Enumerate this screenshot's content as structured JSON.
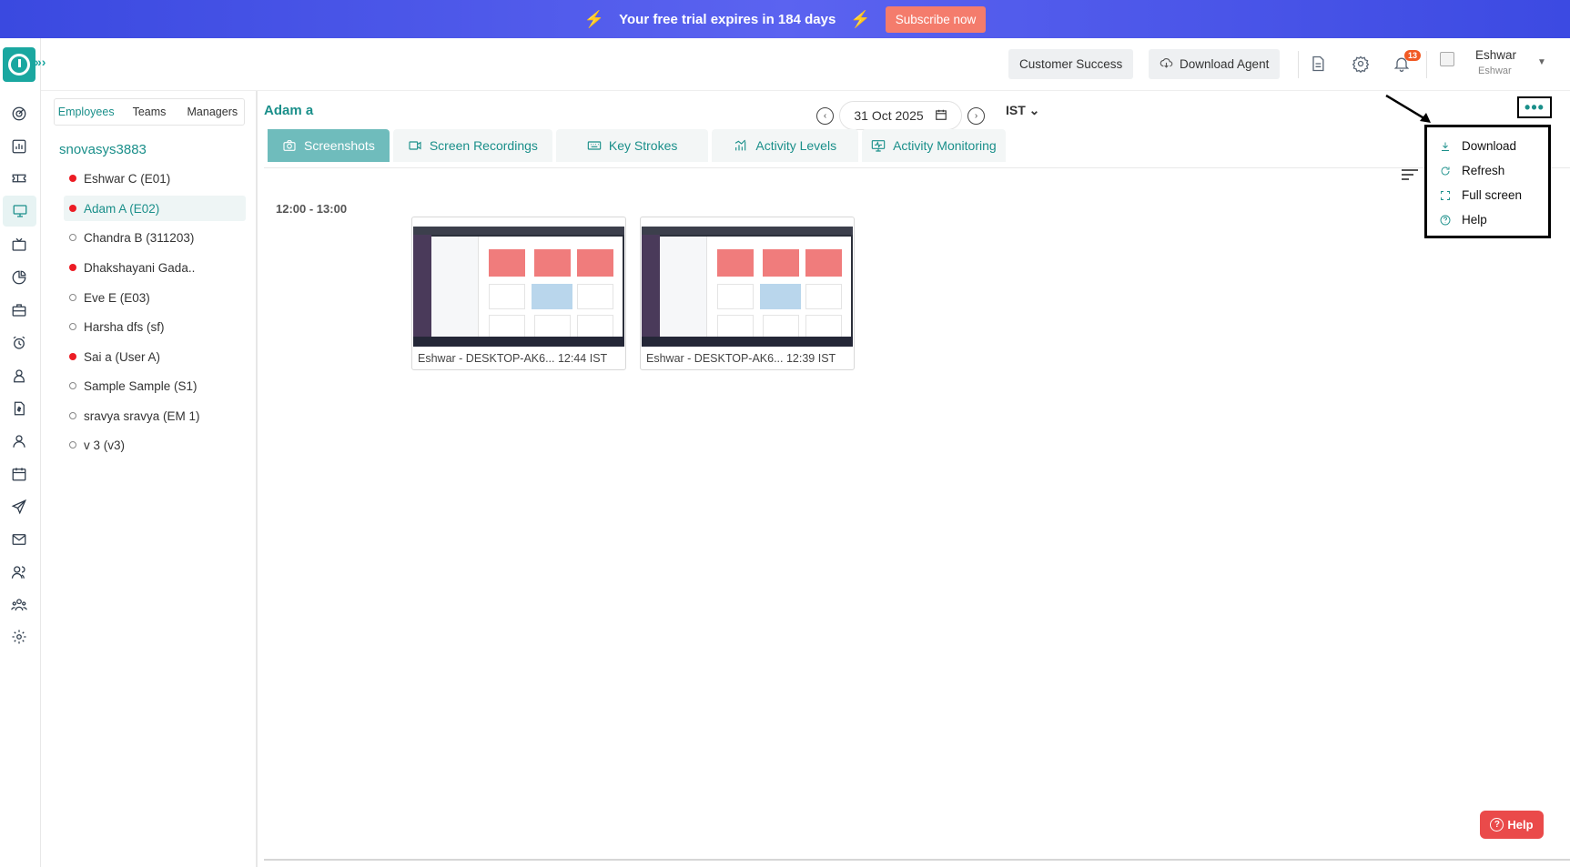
{
  "banner": {
    "message": "Your free trial expires in 184 days",
    "subscribe_label": "Subscribe now"
  },
  "header": {
    "customer_success_label": "Customer Success",
    "download_agent_label": "Download Agent",
    "notification_count": "13",
    "user_name": "Eshwar",
    "user_subtitle": "Eshwar"
  },
  "sidebar": {
    "icons": [
      "dashboard-icon",
      "chart-icon",
      "ticket-icon",
      "monitor-icon",
      "tv-icon",
      "pie-chart-icon",
      "briefcase-icon",
      "alarm-icon",
      "user-badge-icon",
      "invoice-icon",
      "person-icon",
      "calendar-icon",
      "send-icon",
      "mail-icon",
      "users-icon",
      "team-icon",
      "settings-icon"
    ]
  },
  "employee_panel": {
    "segments": [
      "Employees",
      "Teams",
      "Managers"
    ],
    "active_segment": "Employees",
    "org_name": "snovasys3883",
    "employees": [
      {
        "name": "Eshwar C (E01)",
        "online": true
      },
      {
        "name": "Adam A (E02)",
        "online": true,
        "selected": true
      },
      {
        "name": "Chandra B (311203)",
        "online": false
      },
      {
        "name": "Dhakshayani Gada..",
        "online": true
      },
      {
        "name": "Eve E (E03)",
        "online": false
      },
      {
        "name": "Harsha dfs (sf)",
        "online": false
      },
      {
        "name": "Sai a (User A)",
        "online": true
      },
      {
        "name": "Sample Sample (S1)",
        "online": false
      },
      {
        "name": "sravya sravya (EM 1)",
        "online": false
      },
      {
        "name": "v 3 (v3)",
        "online": false
      }
    ]
  },
  "main": {
    "employee_title": "Adam a",
    "date": "31 Oct 2025",
    "timezone": "IST",
    "tabs": [
      {
        "label": "Screenshots",
        "icon": "camera-icon",
        "active": true
      },
      {
        "label": "Screen Recordings",
        "icon": "video-icon",
        "active": false
      },
      {
        "label": "Key Strokes",
        "icon": "keyboard-icon",
        "active": false
      },
      {
        "label": "Activity Levels",
        "icon": "bar-chart-icon",
        "active": false
      },
      {
        "label": "Activity Monitoring",
        "icon": "monitor-pulse-icon",
        "active": false
      }
    ],
    "time_slot": "12:00 - 13:00",
    "screenshots": [
      {
        "caption": "Eshwar - DESKTOP-AK6... 12:44 IST"
      },
      {
        "caption": "Eshwar - DESKTOP-AK6... 12:39 IST"
      }
    ]
  },
  "menu": {
    "items": [
      {
        "label": "Download",
        "icon": "download-icon"
      },
      {
        "label": "Refresh",
        "icon": "refresh-icon"
      },
      {
        "label": "Full screen",
        "icon": "fullscreen-icon"
      },
      {
        "label": "Help",
        "icon": "help-circle-icon"
      }
    ]
  },
  "help_button": {
    "label": "Help"
  },
  "colors": {
    "accent": "#1a8f8a",
    "banner": "#4653e8",
    "subscribe": "#f47c6c",
    "online": "#ec1c24",
    "help": "#ea4a4a"
  }
}
